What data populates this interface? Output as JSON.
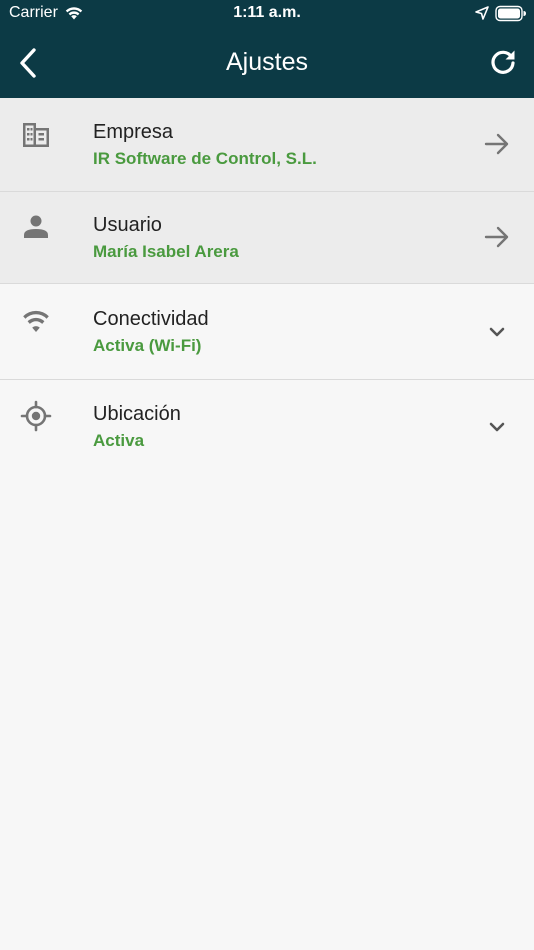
{
  "status_bar": {
    "carrier": "Carrier",
    "time": "1:11 a.m.",
    "icons": [
      "wifi-icon",
      "location-arrow-icon",
      "battery-icon"
    ]
  },
  "app_bar": {
    "title": "Ajustes",
    "back_icon": "chevron-left-icon",
    "refresh_icon": "refresh-icon",
    "background_color": "#0c3a45"
  },
  "settings": [
    {
      "id": "empresa",
      "title": "Empresa",
      "value": "IR Software de Control, S.L.",
      "icon": "building-icon",
      "action": "arrow-right-icon"
    },
    {
      "id": "usuario",
      "title": "Usuario",
      "value": "María Isabel Arera",
      "icon": "person-icon",
      "action": "arrow-right-icon"
    },
    {
      "id": "conectividad",
      "title": "Conectividad",
      "value": "Activa (Wi-Fi)",
      "icon": "wifi-icon",
      "action": "chevron-down-icon"
    },
    {
      "id": "ubicacion",
      "title": "Ubicación",
      "value": "Activa",
      "icon": "gps-target-icon",
      "action": "chevron-down-icon"
    }
  ],
  "colors": {
    "accent_green": "#4a9a3f",
    "icon_gray": "#757575"
  }
}
